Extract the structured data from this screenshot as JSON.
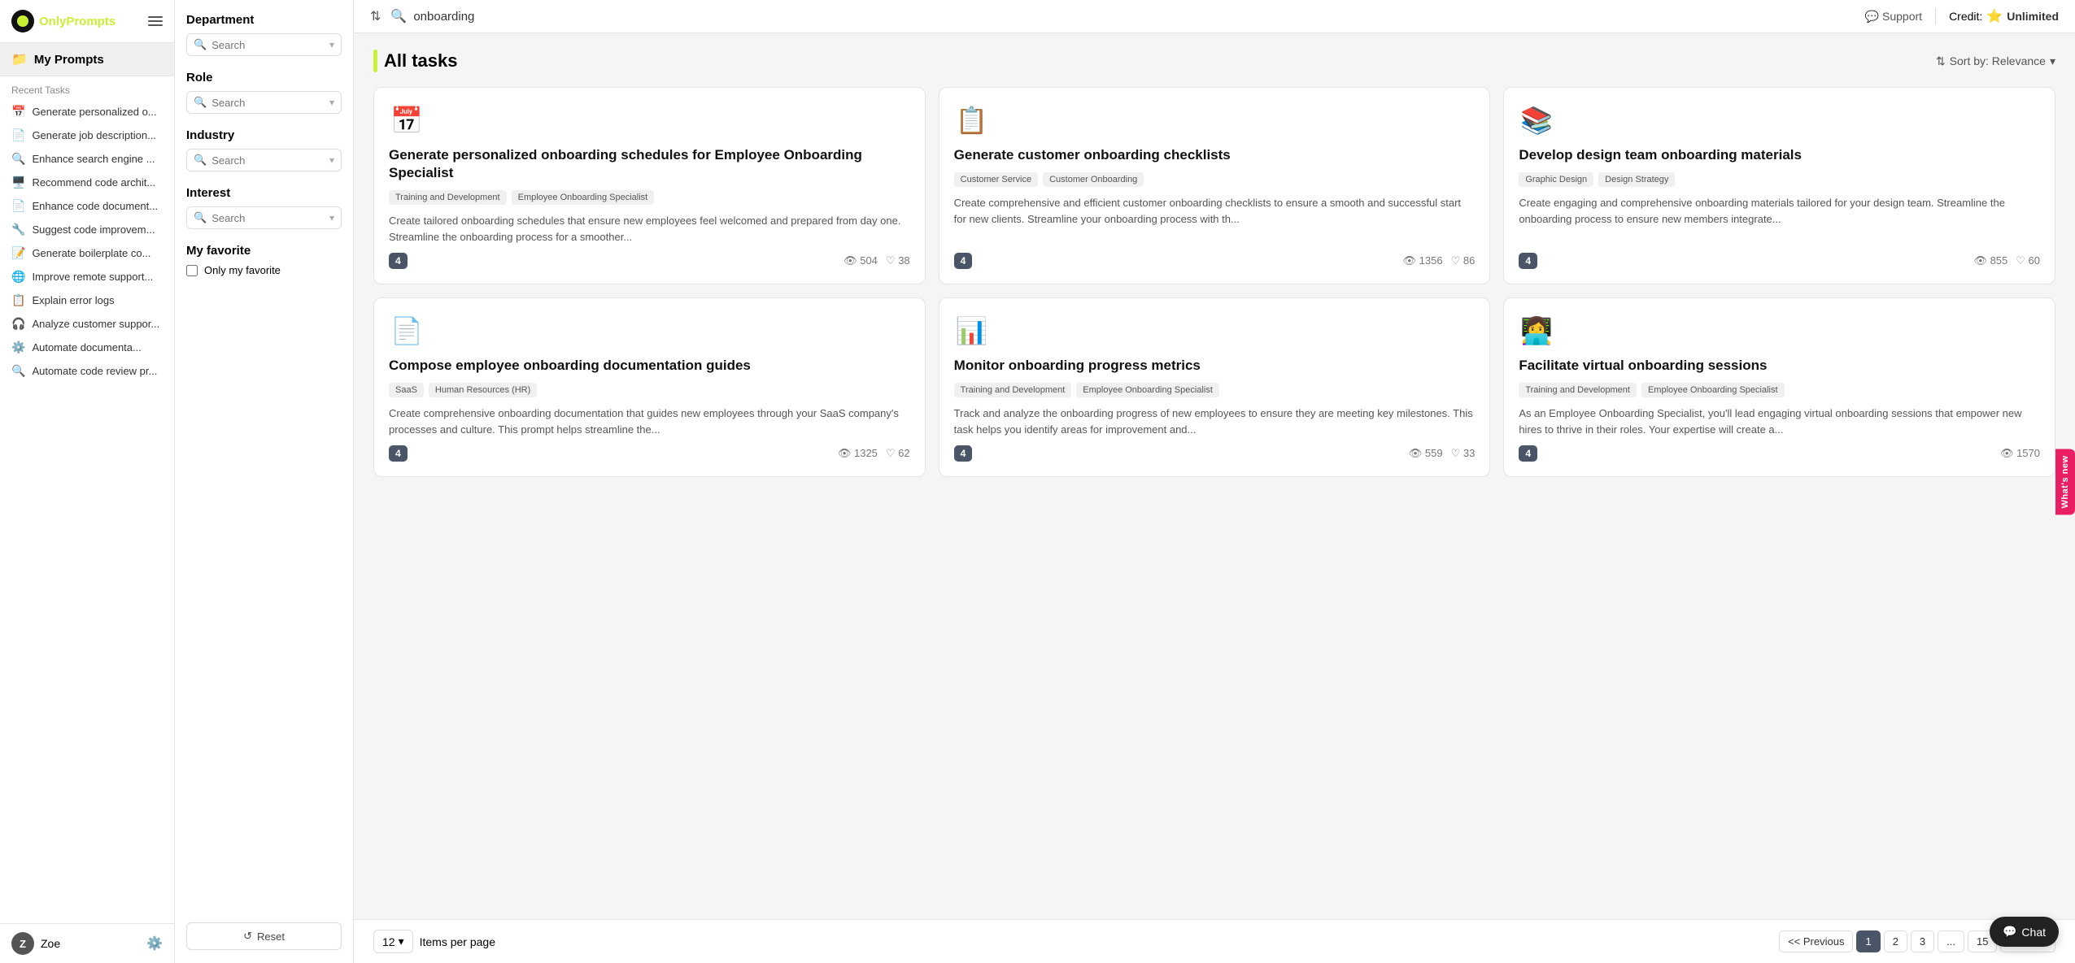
{
  "app": {
    "logo_text_only": "Only",
    "logo_text_prompts": "Prompts",
    "support_label": "Support",
    "credit_label": "Credit:",
    "credit_value": "Unlimited"
  },
  "sidebar": {
    "my_prompts_label": "My Prompts",
    "recent_tasks_label": "Recent Tasks",
    "tasks": [
      {
        "id": 1,
        "icon": "📅",
        "label": "Generate personalized o..."
      },
      {
        "id": 2,
        "icon": "📄",
        "label": "Generate job description..."
      },
      {
        "id": 3,
        "icon": "🔍",
        "label": "Enhance search engine ..."
      },
      {
        "id": 4,
        "icon": "🖥️",
        "label": "Recommend code archit..."
      },
      {
        "id": 5,
        "icon": "📄",
        "label": "Enhance code document..."
      },
      {
        "id": 6,
        "icon": "🔧",
        "label": "Suggest code improvem..."
      },
      {
        "id": 7,
        "icon": "📝",
        "label": "Generate boilerplate co..."
      },
      {
        "id": 8,
        "icon": "🌐",
        "label": "Improve remote support..."
      },
      {
        "id": 9,
        "icon": "📋",
        "label": "Explain error logs"
      },
      {
        "id": 10,
        "icon": "🎧",
        "label": "Analyze customer suppor..."
      },
      {
        "id": 11,
        "icon": "⚙️",
        "label": "Automate documenta..."
      },
      {
        "id": 12,
        "icon": "🔍",
        "label": "Automate code review pr..."
      }
    ],
    "user": {
      "initial": "Z",
      "name": "Zoe"
    }
  },
  "filters": {
    "department_label": "Department",
    "department_placeholder": "Search",
    "role_label": "Role",
    "role_placeholder": "Search",
    "industry_label": "Industry",
    "industry_placeholder": "Search",
    "interest_label": "Interest",
    "interest_placeholder": "Search",
    "my_favorite_label": "My favorite",
    "only_my_favorite_label": "Only my favorite",
    "reset_label": "Reset"
  },
  "topbar": {
    "search_value": "onboarding"
  },
  "main": {
    "all_tasks_label": "All tasks",
    "sort_label": "Sort by: Relevance"
  },
  "cards": [
    {
      "id": 1,
      "icon": "📅",
      "title": "Generate personalized onboarding schedules for Employee Onboarding Specialist",
      "tags": [
        "Training and Development",
        "Employee Onboarding Specialist"
      ],
      "description": "Create tailored onboarding schedules that ensure new employees feel welcomed and prepared from day one. Streamline the onboarding process for a smoother...",
      "level": "4",
      "views": "504",
      "likes": "38"
    },
    {
      "id": 2,
      "icon": "📋",
      "title": "Generate customer onboarding checklists",
      "tags": [
        "Customer Service",
        "Customer Onboarding"
      ],
      "description": "Create comprehensive and efficient customer onboarding checklists to ensure a smooth and successful start for new clients. Streamline your onboarding process with th...",
      "level": "4",
      "views": "1356",
      "likes": "86"
    },
    {
      "id": 3,
      "icon": "📚",
      "title": "Develop design team onboarding materials",
      "tags": [
        "Graphic Design",
        "Design Strategy"
      ],
      "description": "Create engaging and comprehensive onboarding materials tailored for your design team. Streamline the onboarding process to ensure new members integrate...",
      "level": "4",
      "views": "855",
      "likes": "60"
    },
    {
      "id": 4,
      "icon": "📄",
      "title": "Compose employee onboarding documentation guides",
      "tags": [
        "SaaS",
        "Human Resources (HR)"
      ],
      "description": "Create comprehensive onboarding documentation that guides new employees through your SaaS company's processes and culture. This prompt helps streamline the...",
      "level": "4",
      "views": "1325",
      "likes": "62"
    },
    {
      "id": 5,
      "icon": "📊",
      "title": "Monitor onboarding progress metrics",
      "tags": [
        "Training and Development",
        "Employee Onboarding Specialist"
      ],
      "description": "Track and analyze the onboarding progress of new employees to ensure they are meeting key milestones. This task helps you identify areas for improvement and...",
      "level": "4",
      "views": "559",
      "likes": "33"
    },
    {
      "id": 6,
      "icon": "👩‍💻",
      "title": "Facilitate virtual onboarding sessions",
      "tags": [
        "Training and Development",
        "Employee Onboarding Specialist"
      ],
      "description": "As an Employee Onboarding Specialist, you'll lead engaging virtual onboarding sessions that empower new hires to thrive in their roles. Your expertise will create a...",
      "level": "4",
      "views": "1570",
      "likes": ""
    }
  ],
  "pagination": {
    "items_per_page_label": "Items per page",
    "per_page_value": "12",
    "prev_label": "<< Previous",
    "next_label": "Next >>",
    "pages": [
      "1",
      "2",
      "3",
      "...",
      "15"
    ],
    "current_page": "1"
  },
  "whats_new": "What's new",
  "chat_btn_label": "Chat"
}
